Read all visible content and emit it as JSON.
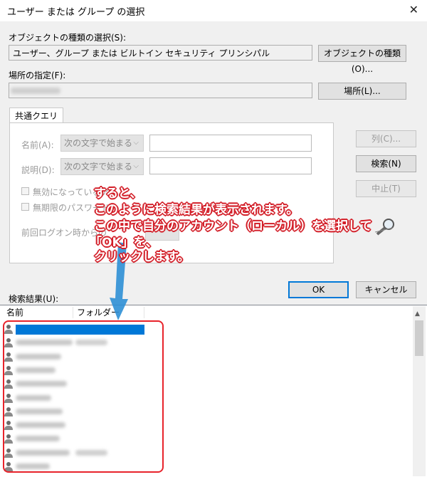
{
  "window": {
    "title": "ユーザー または グループ の選択",
    "close_glyph": "✕"
  },
  "object_type": {
    "label": "オブジェクトの種類の選択(S):",
    "value": "ユーザー、グループ または ビルトイン セキュリティ プリンシパル",
    "button": "オブジェクトの種類(O)..."
  },
  "location": {
    "label": "場所の指定(F):",
    "value": "",
    "button": "場所(L)..."
  },
  "common_query": {
    "tab_label": "共通クエリ",
    "name_label": "名前(A):",
    "name_combo": "次の文字で始まる",
    "desc_label": "説明(D):",
    "desc_combo": "次の文字で始まる",
    "disabled_accounts": "無効になっているア",
    "no_expire_password": "無期限のパスワード",
    "last_logon_label": "前回ログオン時からの"
  },
  "side_buttons": {
    "columns": "列(C)...",
    "search": "検索(N)",
    "stop": "中止(T)"
  },
  "dialog_buttons": {
    "ok": "OK",
    "cancel": "キャンセル"
  },
  "results": {
    "label": "検索結果(U):",
    "columns": [
      "名前",
      "フォルダー"
    ],
    "rows": 11,
    "selected_row": 0
  },
  "annotation": {
    "lines": [
      "すると、",
      "このように検索結果が表示されます。",
      "この中で自分のアカウント（ローカル）を選択して",
      "「OK」を、",
      "クリックします。"
    ],
    "accent_color": "#d3202a",
    "arrow_color": "#2d8fd5"
  },
  "colors": {
    "selection": "#0078d7",
    "highlight_frame": "#e8232b"
  }
}
